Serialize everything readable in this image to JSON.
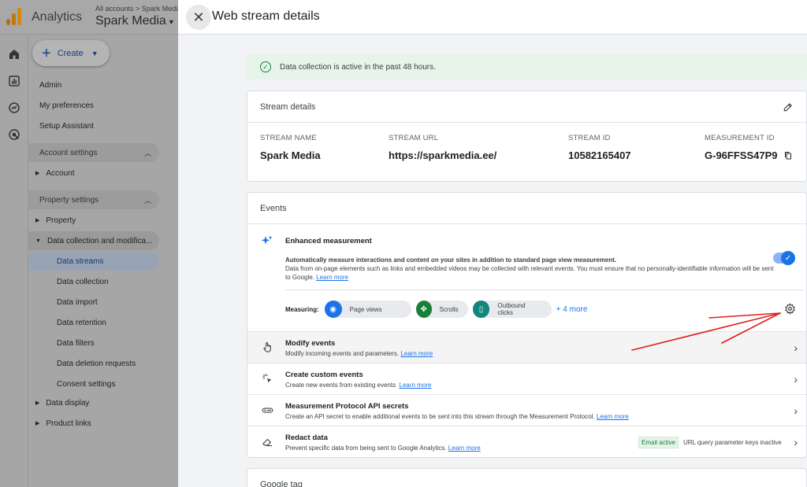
{
  "app": {
    "title": "Analytics",
    "breadcrumb": "All accounts > Spark Media",
    "account": "Spark Media"
  },
  "create_button": {
    "label": "Create"
  },
  "nav": {
    "admin": "Admin",
    "preferences": "My preferences",
    "setup": "Setup Assistant",
    "account_settings": "Account settings",
    "account": "Account",
    "property_settings": "Property settings",
    "property": "Property",
    "data_collection_mod": "Data collection and modifica...",
    "data_streams": "Data streams",
    "data_collection": "Data collection",
    "data_import": "Data import",
    "data_retention": "Data retention",
    "data_filters": "Data filters",
    "data_deletion": "Data deletion requests",
    "consent": "Consent settings",
    "data_display": "Data display",
    "product_links": "Product links"
  },
  "drawer": {
    "title": "Web stream details",
    "notice": "Data collection is active in the past 48 hours."
  },
  "stream_details": {
    "heading": "Stream details",
    "fields": [
      {
        "label": "STREAM NAME",
        "value": "Spark Media"
      },
      {
        "label": "STREAM URL",
        "value": "https://sparkmedia.ee/"
      },
      {
        "label": "STREAM ID",
        "value": "10582165407"
      },
      {
        "label": "MEASUREMENT ID",
        "value": "G-96FFSS47P9"
      }
    ]
  },
  "events": {
    "heading": "Events",
    "enhanced": {
      "title": "Enhanced measurement",
      "desc_bold": "Automatically measure interactions and content on your sites in addition to standard page view measurement.",
      "desc": "Data from on-page elements such as links and embedded videos may be collected with relevant events. You must ensure that no personally-identifiable information will be sent to Google.",
      "learn_more": "Learn more",
      "enabled": true,
      "measuring_label": "Measuring:",
      "chips": [
        "Page views",
        "Scrolls",
        "Outbound clicks"
      ],
      "more": "+ 4 more"
    },
    "rows": [
      {
        "title": "Modify events",
        "desc": "Modify incoming events and parameters.",
        "link": "Learn more"
      },
      {
        "title": "Create custom events",
        "desc": "Create new events from existing events",
        "link": "Learn more"
      },
      {
        "title": "Measurement Protocol API secrets",
        "desc": "Create an API secret to enable additional events to be sent into this stream through the Measurement Protocol.",
        "link": "Learn more"
      },
      {
        "title": "Redact data",
        "desc": "Prevent specific data from being sent to Google Analytics.",
        "link": "Learn more",
        "badge_active": "Email active",
        "badge_inactive": "URL query parameter keys inactive"
      }
    ]
  },
  "google_tag": {
    "heading": "Google tag"
  },
  "colors": {
    "accent": "#1a73e8",
    "success": "#188038",
    "annotation": "#e02020"
  }
}
